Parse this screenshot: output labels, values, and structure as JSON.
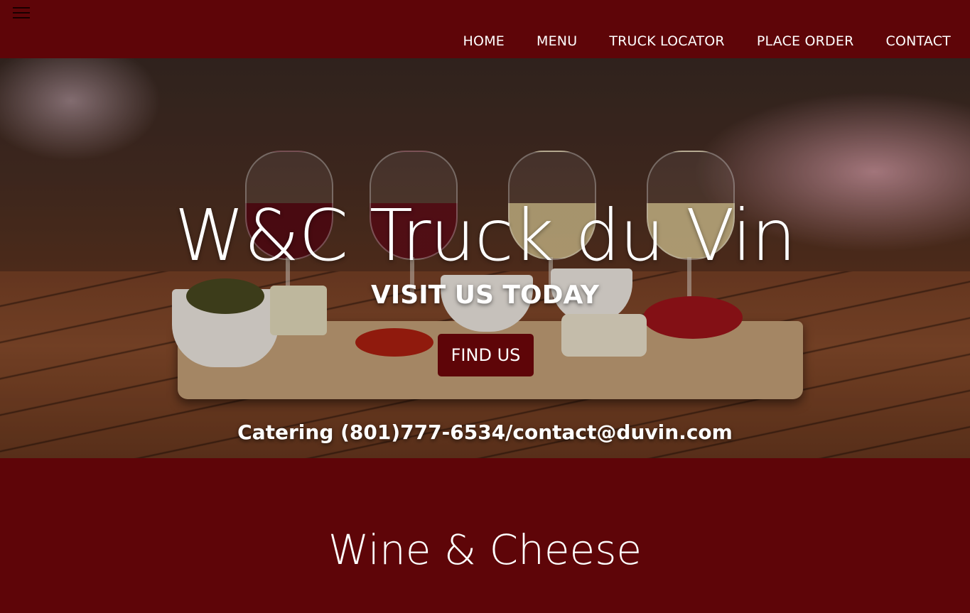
{
  "nav": {
    "items": [
      {
        "label": "HOME"
      },
      {
        "label": "MENU"
      },
      {
        "label": "TRUCK LOCATOR"
      },
      {
        "label": "PLACE ORDER"
      },
      {
        "label": "CONTACT"
      }
    ]
  },
  "hero": {
    "title": "W&C Truck du Vin",
    "subtitle": "VISIT US TODAY",
    "button_label": "FIND US",
    "catering_text": "Catering (801)777-6534/contact@duvin.com"
  },
  "section": {
    "title": "Wine & Cheese"
  },
  "colors": {
    "brand": "#5e0508",
    "text": "#ffffff"
  },
  "icons": {
    "menu": "hamburger-icon"
  }
}
